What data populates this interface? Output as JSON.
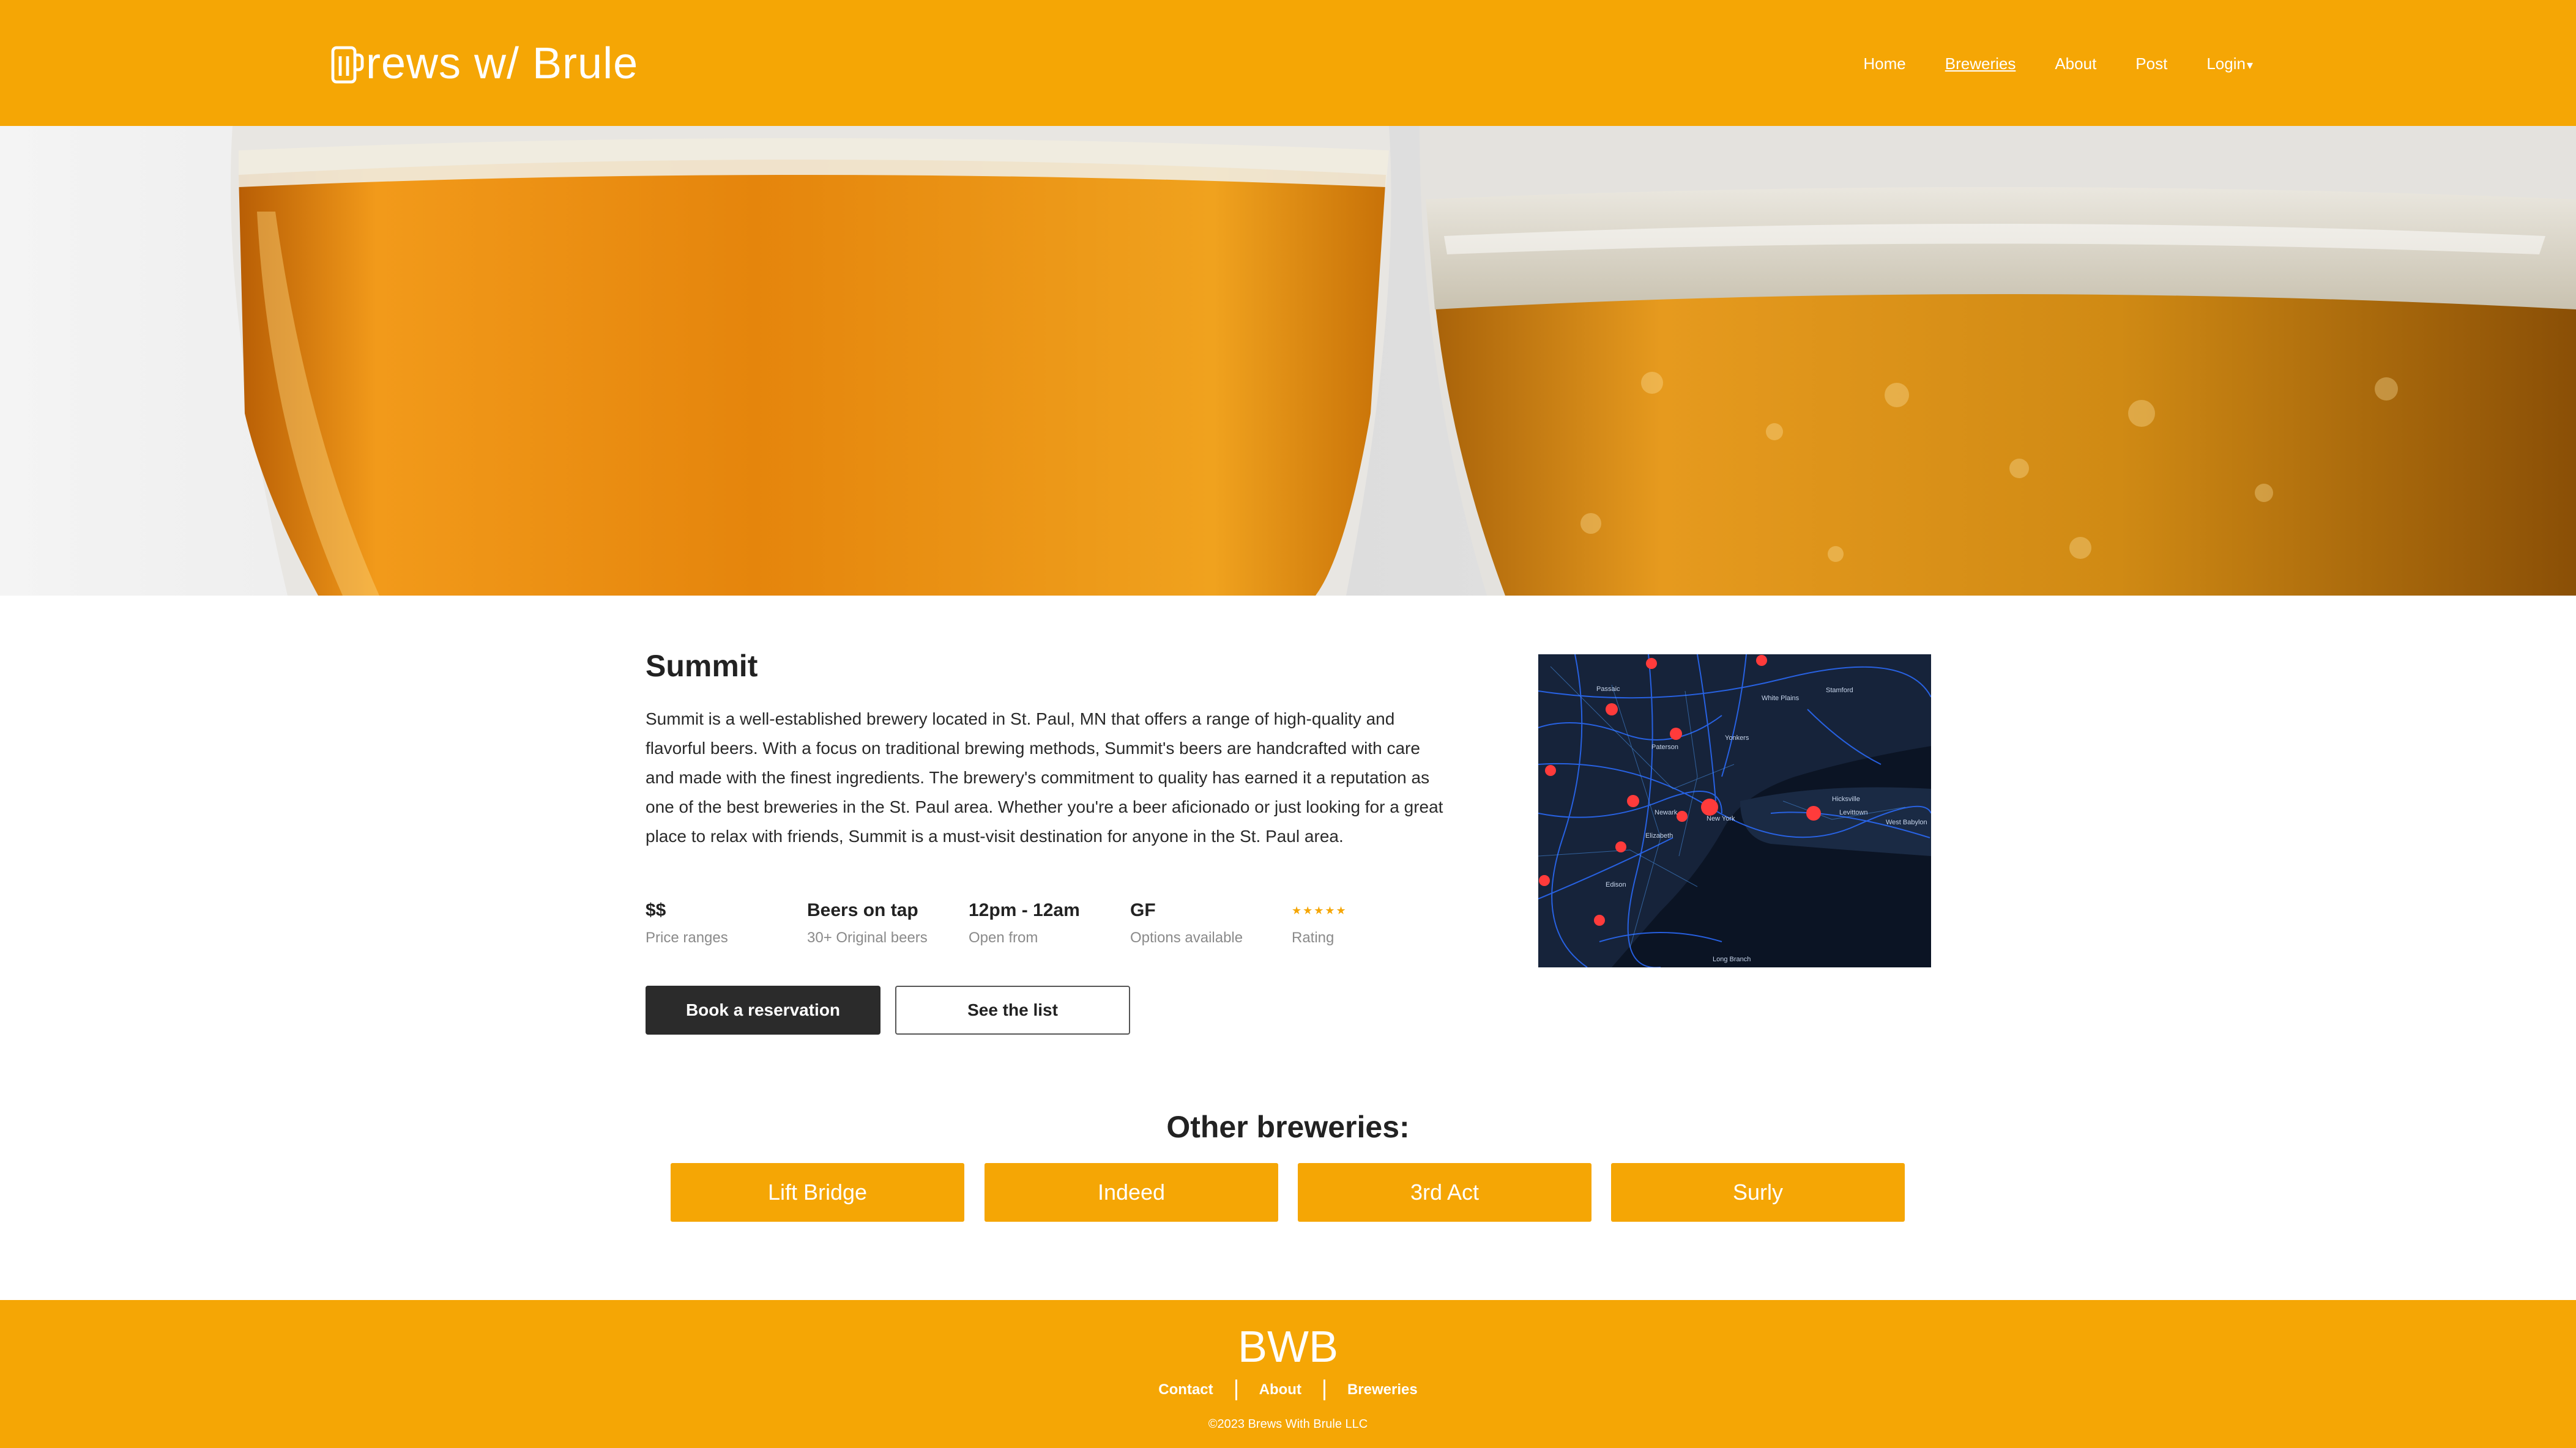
{
  "header": {
    "logo_text": "rews w/ Brule",
    "nav": [
      {
        "label": "Home",
        "active": false
      },
      {
        "label": "Breweries",
        "active": true
      },
      {
        "label": "About",
        "active": false
      },
      {
        "label": "Post",
        "active": false
      },
      {
        "label": "Login",
        "active": false
      }
    ],
    "login_caret": "▾"
  },
  "brewery": {
    "name": "Summit",
    "description": "Summit is a well-established brewery located in St. Paul, MN that offers a range of high-quality and flavorful beers. With a focus on traditional brewing methods, Summit's beers are handcrafted with care and made with the finest ingredients. The brewery's commitment to quality has earned it a reputation as one of the best breweries in the St. Paul area. Whether you're a beer aficionado or just looking for a great place to relax with friends, Summit is a must-visit destination for anyone in the St. Paul area.",
    "stats": [
      {
        "value": "$$",
        "label": "Price ranges"
      },
      {
        "value": "Beers on tap",
        "label": "30+ Original beers"
      },
      {
        "value": "12pm - 12am",
        "label": "Open from"
      },
      {
        "value": "GF",
        "label": "Options available"
      },
      {
        "value": "★★★★★",
        "label": "Rating"
      }
    ],
    "rating": 5,
    "buttons": {
      "reserve": "Book a reservation",
      "list": "See the list"
    }
  },
  "map": {
    "labels": [
      "Passaic",
      "White Plains",
      "Stamford",
      "Paterson",
      "Yonkers",
      "New York",
      "Newark",
      "Hicksville",
      "Levittown",
      "West Babylon",
      "Elizabeth",
      "Edison",
      "Long Branch"
    ]
  },
  "other": {
    "title": "Other breweries:",
    "items": [
      "Lift Bridge",
      "Indeed",
      "3rd Act",
      "Surly"
    ]
  },
  "footer": {
    "brand": "BWB",
    "links": [
      "Contact",
      "About",
      "Breweries"
    ],
    "copyright": "©2023 Brews With Brule LLC"
  },
  "colors": {
    "accent": "#f5a605",
    "dark_button": "#2b2b2b",
    "map_bg": "#0b1424"
  }
}
